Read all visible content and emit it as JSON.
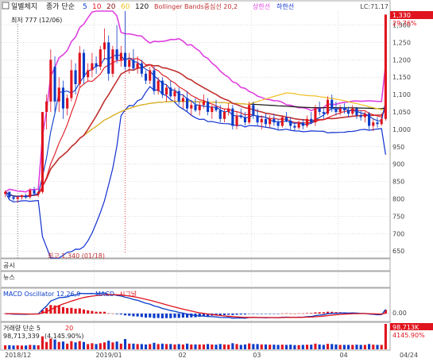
{
  "colors": {
    "background": "#ffffff",
    "frame": "#aaaaaa",
    "grid": "#c8c8c8",
    "up": "#e0141e",
    "down": "#0a3cc8",
    "ma5": "#0a3cc8",
    "ma10": "#e0141e",
    "ma20": "#8c1010",
    "ma60": "#f0c020",
    "ma120": "#111111",
    "bb_mid": "#c03030",
    "bb_upper": "#e040e0",
    "bb_lower": "#1030d0",
    "macd": "#0a3cc8",
    "signal": "#e0141e",
    "highlight": "#e0141e"
  },
  "price_header": {
    "title": "일별체지",
    "ma_prefix": "종가 단순",
    "ma_periods": [
      {
        "label": "5",
        "color": "#0a3cc8"
      },
      {
        "label": "10",
        "color": "#e0141e"
      },
      {
        "label": "20",
        "color": "#8c1010"
      },
      {
        "label": "60",
        "color": "#f0c020"
      },
      {
        "label": "120",
        "color": "#111111"
      }
    ],
    "bollinger": "Bollinger Bands중심선 20,2",
    "upper": "상한선",
    "lower": "하한선",
    "corner_right": "LC:71.17"
  },
  "annotations": {
    "low": "최저 777 (12/06)",
    "high": "최고 1,340 (01/18)"
  },
  "price_badges": {
    "price": "1,330",
    "change": "29.76%"
  },
  "y_axis": {
    "ticks": [
      650,
      700,
      750,
      800,
      850,
      900,
      950,
      1000,
      1050,
      1100,
      1150,
      1200,
      1250,
      1300
    ]
  },
  "x_axis": {
    "ticks": [
      {
        "label": "2018/12",
        "idx": 0
      },
      {
        "label": "2019/01",
        "idx": 22
      },
      {
        "label": "02",
        "idx": 42
      },
      {
        "label": "03",
        "idx": 60
      },
      {
        "label": "04",
        "idx": 81
      }
    ],
    "end_label": "04/24"
  },
  "panels": {
    "disclosure": "공시",
    "news": "뉴스",
    "macd_title": "MACD Oscillator 12,26,9",
    "macd_label": "MACD",
    "signal_label": "시그널",
    "macd_tick": "0.00",
    "volume_title": "거래량 단순 5",
    "volume_ma": "20",
    "volume_value": "98,713,339",
    "volume_change": "(4,145.90%)",
    "volume_badge_value": "98,713K",
    "volume_badge_change": "4145.90%"
  },
  "chart_data": {
    "type": "candlestick",
    "title": "일별체지",
    "ylim": [
      630,
      1340
    ],
    "grid": true,
    "candles": [
      [
        815,
        825,
        805,
        820
      ],
      [
        820,
        822,
        800,
        805
      ],
      [
        805,
        810,
        795,
        800
      ],
      [
        800,
        808,
        790,
        805
      ],
      [
        805,
        812,
        798,
        810
      ],
      [
        810,
        815,
        800,
        805
      ],
      [
        805,
        830,
        800,
        825
      ],
      [
        825,
        835,
        810,
        815
      ],
      [
        815,
        825,
        805,
        820
      ],
      [
        820,
        1050,
        815,
        1050
      ],
      [
        1050,
        1100,
        1000,
        1080
      ],
      [
        1080,
        1230,
        1050,
        1200
      ],
      [
        1180,
        1210,
        1050,
        1080
      ],
      [
        1080,
        1150,
        1050,
        1120
      ],
      [
        1120,
        1140,
        1030,
        1060
      ],
      [
        1060,
        1100,
        1040,
        1090
      ],
      [
        1090,
        1200,
        1080,
        1170
      ],
      [
        1170,
        1190,
        1100,
        1130
      ],
      [
        1130,
        1240,
        1120,
        1220
      ],
      [
        1220,
        1230,
        1130,
        1150
      ],
      [
        1150,
        1190,
        1140,
        1170
      ],
      [
        1170,
        1220,
        1150,
        1190
      ],
      [
        1190,
        1210,
        1160,
        1180
      ],
      [
        1180,
        1240,
        1170,
        1230
      ],
      [
        1230,
        1290,
        1200,
        1250
      ],
      [
        1250,
        1270,
        1140,
        1160
      ],
      [
        1160,
        1240,
        1150,
        1230
      ],
      [
        1230,
        1300,
        1190,
        1200
      ],
      [
        1200,
        1240,
        1180,
        1220
      ],
      [
        1220,
        1340,
        1170,
        1180
      ],
      [
        1180,
        1220,
        1160,
        1200
      ],
      [
        1200,
        1230,
        1170,
        1175
      ],
      [
        1175,
        1210,
        1160,
        1190
      ],
      [
        1190,
        1200,
        1150,
        1160
      ],
      [
        1160,
        1170,
        1130,
        1140
      ],
      [
        1140,
        1180,
        1130,
        1170
      ],
      [
        1170,
        1180,
        1100,
        1110
      ],
      [
        1110,
        1150,
        1100,
        1140
      ],
      [
        1140,
        1150,
        1090,
        1100
      ],
      [
        1100,
        1130,
        1080,
        1120
      ],
      [
        1120,
        1140,
        1090,
        1095
      ],
      [
        1095,
        1120,
        1080,
        1110
      ],
      [
        1110,
        1120,
        1070,
        1080
      ],
      [
        1080,
        1100,
        1060,
        1090
      ],
      [
        1090,
        1110,
        1050,
        1060
      ],
      [
        1060,
        1080,
        1040,
        1070
      ],
      [
        1070,
        1090,
        1050,
        1055
      ],
      [
        1055,
        1080,
        1040,
        1070
      ],
      [
        1070,
        1100,
        1060,
        1080
      ],
      [
        1080,
        1090,
        1040,
        1050
      ],
      [
        1050,
        1070,
        1030,
        1065
      ],
      [
        1065,
        1085,
        1050,
        1055
      ],
      [
        1055,
        1070,
        1020,
        1030
      ],
      [
        1030,
        1060,
        1020,
        1050
      ],
      [
        1050,
        1075,
        1040,
        1060
      ],
      [
        1060,
        1070,
        1000,
        1010
      ],
      [
        1010,
        1050,
        1000,
        1040
      ],
      [
        1040,
        1060,
        1030,
        1035
      ],
      [
        1035,
        1050,
        1010,
        1020
      ],
      [
        1020,
        1080,
        1015,
        1070
      ],
      [
        1070,
        1080,
        1030,
        1040
      ],
      [
        1040,
        1060,
        1010,
        1020
      ],
      [
        1020,
        1040,
        1000,
        1030
      ],
      [
        1030,
        1045,
        1005,
        1015
      ],
      [
        1015,
        1040,
        1005,
        1030
      ],
      [
        1030,
        1045,
        1010,
        1020
      ],
      [
        1020,
        1030,
        1000,
        1010
      ],
      [
        1010,
        1040,
        1005,
        1035
      ],
      [
        1035,
        1050,
        1020,
        1025
      ],
      [
        1025,
        1035,
        1000,
        1010
      ],
      [
        1010,
        1020,
        995,
        1005
      ],
      [
        1005,
        1025,
        1000,
        1020
      ],
      [
        1020,
        1030,
        1000,
        1010
      ],
      [
        1010,
        1040,
        1005,
        1030
      ],
      [
        1030,
        1050,
        1015,
        1020
      ],
      [
        1020,
        1070,
        1010,
        1060
      ],
      [
        1060,
        1080,
        1040,
        1050
      ],
      [
        1050,
        1060,
        1030,
        1045
      ],
      [
        1045,
        1095,
        1040,
        1085
      ],
      [
        1085,
        1100,
        1050,
        1060
      ],
      [
        1060,
        1080,
        1040,
        1050
      ],
      [
        1050,
        1070,
        1040,
        1060
      ],
      [
        1060,
        1075,
        1045,
        1055
      ],
      [
        1055,
        1065,
        1035,
        1045
      ],
      [
        1045,
        1070,
        1040,
        1060
      ],
      [
        1060,
        1065,
        1030,
        1040
      ],
      [
        1040,
        1055,
        1025,
        1035
      ],
      [
        1035,
        1050,
        1020,
        1045
      ],
      [
        1045,
        1050,
        1000,
        1010
      ],
      [
        1010,
        1030,
        995,
        1020
      ],
      [
        1020,
        1035,
        1005,
        1015
      ],
      [
        1015,
        1040,
        1010,
        1030
      ],
      [
        1030,
        1330,
        1025,
        1330
      ]
    ]
  }
}
